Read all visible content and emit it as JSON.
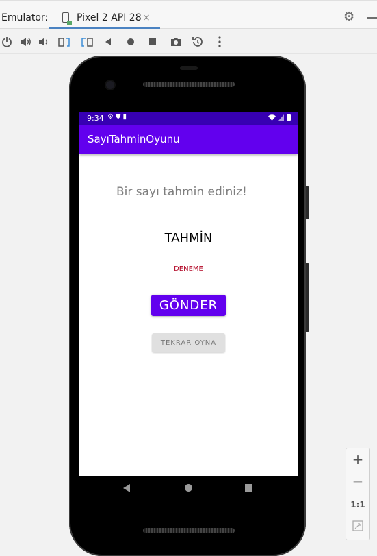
{
  "emulator": {
    "label": "Emulator:",
    "tab": {
      "title": "Pixel 2 API 28",
      "close": "×"
    }
  },
  "toolbar": {
    "buttons": [
      {
        "name": "power-icon"
      },
      {
        "name": "volume-up-icon"
      },
      {
        "name": "volume-down-icon"
      },
      {
        "name": "rotate-left-icon"
      },
      {
        "name": "rotate-right-icon"
      },
      {
        "name": "back-icon"
      },
      {
        "name": "home-icon"
      },
      {
        "name": "overview-icon"
      },
      {
        "name": "camera-icon"
      },
      {
        "name": "snapshot-icon"
      },
      {
        "name": "more-icon"
      }
    ]
  },
  "device": {
    "status": {
      "time": "9:34"
    },
    "app": {
      "title": "SayıTahminOyunu",
      "input_placeholder": "Bir sayı tahmin ediniz!",
      "input_value": "",
      "guess_label": "TAHMİN",
      "result_label": "DENEME",
      "submit_button": "GÖNDER",
      "replay_button": "TEKRAR OYNA"
    }
  },
  "zoom": {
    "plus": "+",
    "minus": "−",
    "ratio": "1:1"
  },
  "colors": {
    "primary": "#6200ee",
    "primary_dark": "#3700b3",
    "error": "#b00020"
  }
}
